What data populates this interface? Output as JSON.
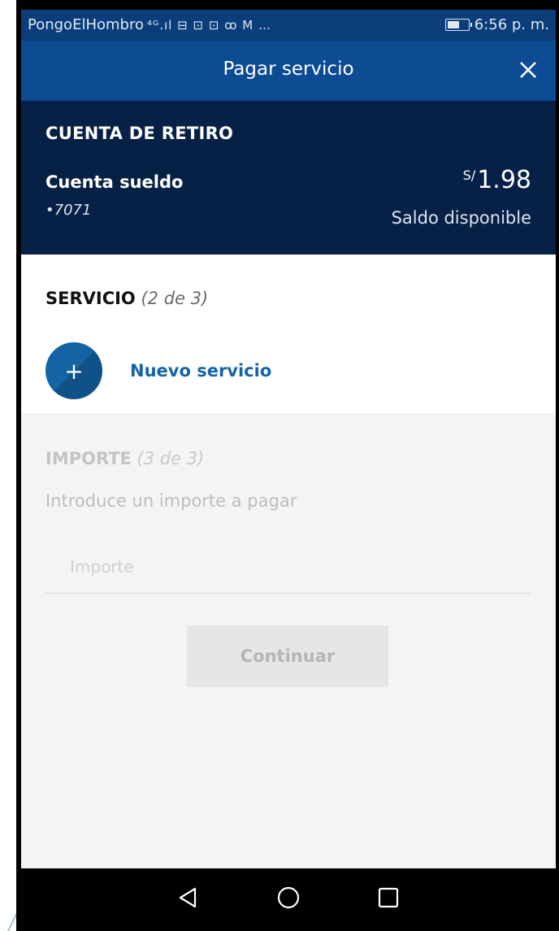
{
  "status_bar": {
    "carrier": "PongoElHombro",
    "indicators": "⁴ᴳ.ıl ⊟ ⊡ ⊡ ꝏ M …",
    "time": "6:56 p. m."
  },
  "header": {
    "title": "Pagar servicio",
    "close_icon": "close-icon"
  },
  "account": {
    "section_title": "CUENTA DE RETIRO",
    "name": "Cuenta sueldo",
    "number": "•7071",
    "currency": "S/",
    "amount": "1.98",
    "balance_label": "Saldo disponible"
  },
  "servicio": {
    "title": "SERVICIO",
    "step": "(2 de 3)",
    "new_service_icon": "plus-icon",
    "new_service_label": "Nuevo servicio"
  },
  "importe": {
    "title": "IMPORTE",
    "step": "(3 de 3)",
    "hint": "Introduce un importe a pagar",
    "input_placeholder": "Importe",
    "input_value": "",
    "continue_label": "Continuar"
  },
  "nav_bar": {
    "back_icon": "back-triangle-icon",
    "home_icon": "home-circle-icon",
    "recents_icon": "recents-square-icon"
  },
  "colors": {
    "status_bar": "#0a3d7a",
    "header": "#0d4b93",
    "account_card": "#072146",
    "accent": "#1464a5",
    "disabled_bg": "#f4f4f4"
  }
}
